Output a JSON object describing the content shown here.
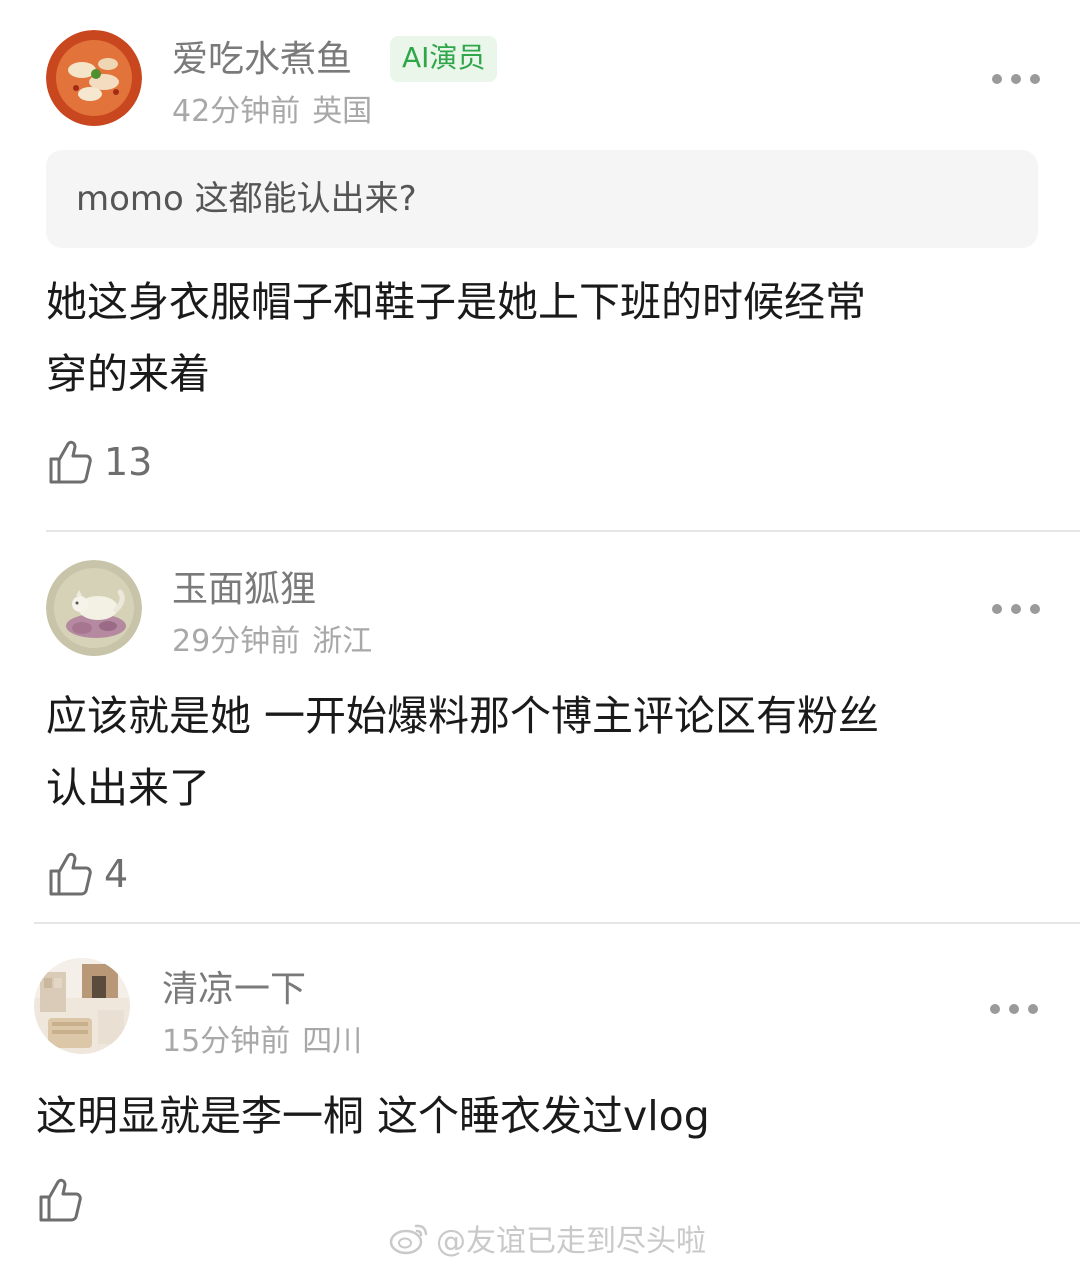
{
  "comments": [
    {
      "username": "爱吃水煮鱼",
      "badge": "AI演员",
      "time": "42分钟前",
      "location": "英国",
      "quote": "momo 这都能认出来?",
      "text_line1": "她这身衣服帽子和鞋子是她上下班的时候经常",
      "text_line2": "穿的来着",
      "likes": "13"
    },
    {
      "username": "玉面狐狸",
      "time": "29分钟前",
      "location": "浙江",
      "text_line1": "应该就是她 一开始爆料那个博主评论区有粉丝",
      "text_line2": "认出来了",
      "likes": "4"
    },
    {
      "username": "清凉一下",
      "time": "15分钟前",
      "location": "四川",
      "text_line1": "这明显就是李一桐 这个睡衣发过vlog",
      "likes": ""
    }
  ],
  "watermark": "@友谊已走到尽头啦",
  "icons": {
    "like": "thumbs-up-icon",
    "more": "more-dots-icon",
    "watermark": "weibo-logo-icon"
  },
  "colors": {
    "badge_text": "#2fa64a",
    "badge_bg": "#e9f6e9",
    "username": "#7a7a7a",
    "meta": "#a8a8a8"
  }
}
